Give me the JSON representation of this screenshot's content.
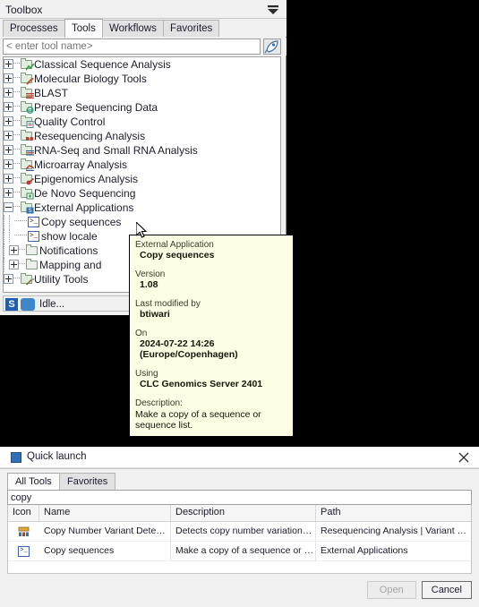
{
  "toolbox": {
    "title": "Toolbox",
    "minimize_icon": "minimize-triangle-icon",
    "tabs": [
      {
        "label": "Processes",
        "active": false
      },
      {
        "label": "Tools",
        "active": true
      },
      {
        "label": "Workflows",
        "active": false
      },
      {
        "label": "Favorites",
        "active": false
      }
    ],
    "search": {
      "value": "",
      "placeholder": "< enter tool name>",
      "launch_icon": "rocket-icon"
    },
    "tree": [
      {
        "label": "Classical Sequence Analysis",
        "depth": 0,
        "expander": "plus",
        "icon": "folder-chart-icon"
      },
      {
        "label": "Molecular Biology Tools",
        "depth": 0,
        "expander": "plus",
        "icon": "folder-pencil-icon"
      },
      {
        "label": "BLAST",
        "depth": 0,
        "expander": "plus",
        "icon": "folder-align-icon"
      },
      {
        "label": "Prepare Sequencing Data",
        "depth": 0,
        "expander": "plus",
        "icon": "folder-circle-icon"
      },
      {
        "label": "Quality Control",
        "depth": 0,
        "expander": "plus",
        "icon": "folder-clipboard-icon"
      },
      {
        "label": "Resequencing Analysis",
        "depth": 0,
        "expander": "plus",
        "icon": "folder-reads-icon"
      },
      {
        "label": "RNA-Seq and Small RNA Analysis",
        "depth": 0,
        "expander": "plus",
        "icon": "folder-rna-icon"
      },
      {
        "label": "Microarray Analysis",
        "depth": 0,
        "expander": "plus",
        "icon": "folder-array-icon"
      },
      {
        "label": "Epigenomics Analysis",
        "depth": 0,
        "expander": "plus",
        "icon": "folder-epi-icon"
      },
      {
        "label": "De Novo Sequencing",
        "depth": 0,
        "expander": "plus",
        "icon": "folder-denovo-icon"
      },
      {
        "label": "External Applications",
        "depth": 0,
        "expander": "minus",
        "icon": "folder-script-icon"
      },
      {
        "label": "Copy sequences",
        "depth": 1,
        "expander": "none",
        "icon": "console-icon"
      },
      {
        "label": "show locale",
        "depth": 1,
        "expander": "none",
        "icon": "console-icon"
      },
      {
        "label": "Notifications",
        "depth": 1,
        "expander": "plus",
        "icon": "folder-plain-icon"
      },
      {
        "label": "Mapping and ",
        "depth": 1,
        "expander": "plus",
        "icon": "folder-plain-icon"
      },
      {
        "label": "Utility Tools",
        "depth": 0,
        "expander": "plus",
        "icon": "folder-tools-icon"
      }
    ],
    "status": {
      "badge": "S",
      "cloud_icon": "cloud-icon",
      "text": "Idle..."
    }
  },
  "tooltip": {
    "kind_label": "External Application",
    "kind_value": "Copy sequences",
    "version_label": "Version",
    "version_value": "1.08",
    "modified_label": "Last modified by",
    "modified_value": "btiwari",
    "on_label": "On",
    "on_value": "2024-07-22 14:26 (Europe/Copenhagen)",
    "using_label": "Using",
    "using_value": "CLC Genomics Server 2401",
    "description_label": "Description:",
    "description_value": "Make a copy of a sequence or sequence list."
  },
  "dialog": {
    "title": "Quick launch",
    "app_icon": "app-icon",
    "close_icon": "close-icon",
    "tabs": [
      {
        "label": "All Tools",
        "active": true
      },
      {
        "label": "Favorites",
        "active": false
      }
    ],
    "search": {
      "value": "copy",
      "placeholder": ""
    },
    "table": {
      "columns": [
        "Icon",
        "Name",
        "Description",
        "Path"
      ],
      "rows": [
        {
          "icon": "cnv-tool-icon",
          "name": "Copy Number Variant Detection (CNVs)",
          "description": "Detects copy number variations in targeted ...",
          "path": "Resequencing Analysis | Variant Detection"
        },
        {
          "icon": "console-icon",
          "name": "Copy sequences",
          "description": "Make a copy of a sequence or sequence list.",
          "path": "External Applications"
        }
      ]
    },
    "buttons": {
      "open": "Open",
      "cancel": "Cancel"
    }
  }
}
